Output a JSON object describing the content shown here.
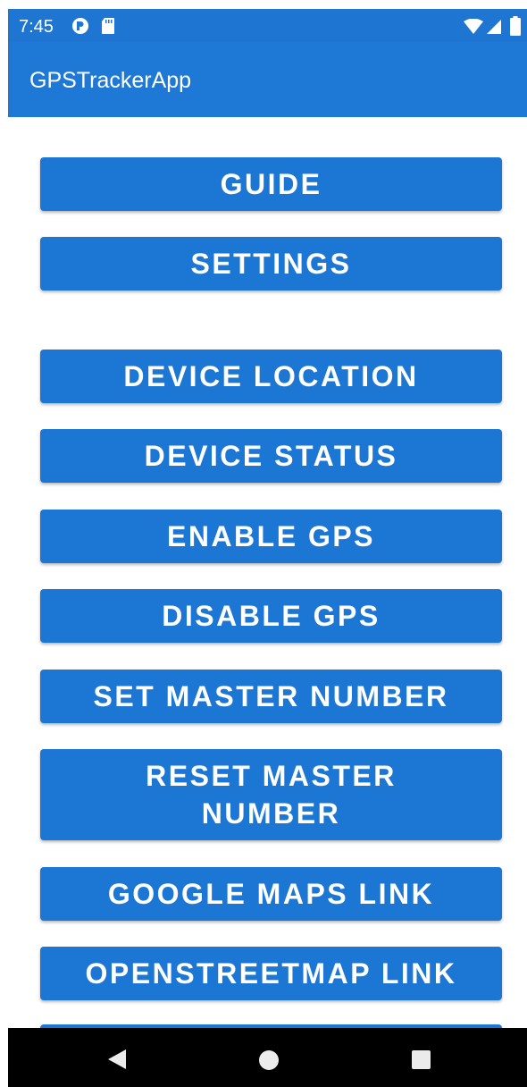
{
  "status_bar": {
    "time": "7:45",
    "icons": [
      "play-protect-icon",
      "sd-card-icon",
      "wifi-icon",
      "signal-icon",
      "battery-icon"
    ]
  },
  "app_bar": {
    "title": "GPSTrackerApp"
  },
  "buttons": {
    "guide": "GUIDE",
    "settings": "SETTINGS",
    "device_location": "DEVICE LOCATION",
    "device_status": "DEVICE STATUS",
    "enable_gps": "ENABLE GPS",
    "disable_gps": "DISABLE GPS",
    "set_master_number": "SET MASTER NUMBER",
    "reset_master_number": "RESET MASTER NUMBER",
    "google_maps_link": "GOOGLE MAPS LINK",
    "openstreetmap_link": "OPENSTREETMAP LINK"
  },
  "nav_bar": {
    "icons": [
      "back-icon",
      "home-icon",
      "recents-icon"
    ]
  },
  "colors": {
    "primary": "#1e78d5",
    "status_bar": "#1f75d2",
    "button": "#1c76d4",
    "nav_bar": "#000000",
    "on_primary": "#ffffff"
  }
}
